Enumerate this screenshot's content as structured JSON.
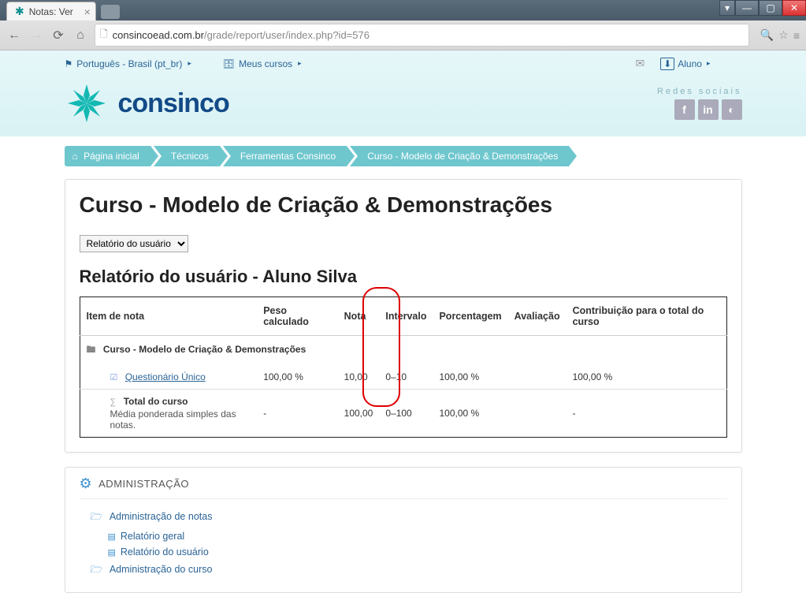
{
  "browser": {
    "tab_title": "Notas: Ver",
    "url_domain": "consincoead.com.br",
    "url_path": "/grade/report/user/index.php?id=576"
  },
  "top_bar": {
    "language": "Português - Brasil (pt_br)",
    "my_courses": "Meus cursos",
    "user_label": "Aluno"
  },
  "branding": {
    "name": "consinco",
    "social_label": "Redes sociais"
  },
  "breadcrumb": [
    "Página inicial",
    "Técnicos",
    "Ferramentas Consinco",
    "Curso - Modelo de Criação & Demonstrações"
  ],
  "page": {
    "title": "Curso - Modelo de Criação & Demonstrações",
    "report_selector": "Relatório do usuário",
    "report_title": "Relatório do usuário - Aluno Silva"
  },
  "table": {
    "headers": {
      "item": "Item de nota",
      "weight": "Peso calculado",
      "grade": "Nota",
      "range": "Intervalo",
      "percentage": "Porcentagem",
      "feedback": "Avaliação",
      "contribution": "Contribuição para o total do curso"
    },
    "folder_row": "Curso - Modelo de Criação & Demonstrações",
    "quiz_row": {
      "name": "Questionário Único",
      "weight": "100,00 %",
      "grade": "10,00",
      "range": "0–10",
      "percentage": "100,00 %",
      "feedback": "",
      "contribution": "100,00 %"
    },
    "total_row": {
      "name": "Total do curso",
      "subtext": "Média ponderada simples das notas.",
      "weight": "-",
      "grade": "100,00",
      "range": "0–100",
      "percentage": "100,00 %",
      "feedback": "",
      "contribution": "-"
    }
  },
  "admin": {
    "title": "ADMINISTRAÇÃO",
    "grade_admin": "Administração de notas",
    "report_general": "Relatório geral",
    "report_user": "Relatório do usuário",
    "course_admin": "Administração do curso"
  }
}
